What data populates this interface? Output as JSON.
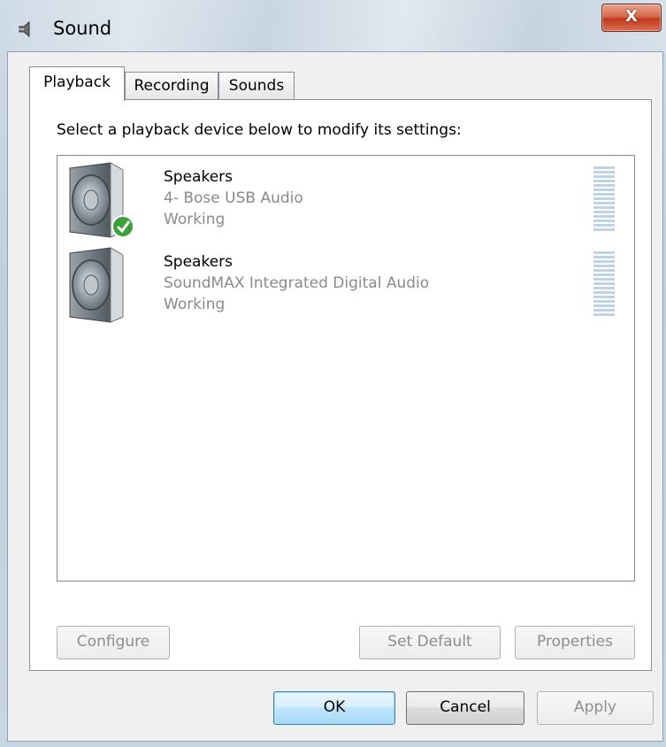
{
  "window": {
    "title": "Sound",
    "close_label": "X"
  },
  "tabs": [
    {
      "label": "Playback",
      "active": true
    },
    {
      "label": "Recording",
      "active": false
    },
    {
      "label": "Sounds",
      "active": false
    }
  ],
  "instruction": "Select a playback device below to modify its settings:",
  "devices": [
    {
      "name": "Speakers",
      "description": "4- Bose USB Audio",
      "status": "Working",
      "is_default": true
    },
    {
      "name": "Speakers",
      "description": "SoundMAX Integrated Digital Audio",
      "status": "Working",
      "is_default": false
    }
  ],
  "panel_buttons": {
    "configure": "Configure",
    "set_default": "Set Default",
    "properties": "Properties"
  },
  "dialog_buttons": {
    "ok": "OK",
    "cancel": "Cancel",
    "apply": "Apply"
  },
  "icons": {
    "title": "speaker-icon",
    "device": "speaker-icon",
    "default_badge": "green-check-icon"
  },
  "colors": {
    "close_button": "#c0391d",
    "default_badge": "#3aa13a",
    "meter": "#bcd4e6",
    "disabled_text": "#8a8a8a"
  }
}
